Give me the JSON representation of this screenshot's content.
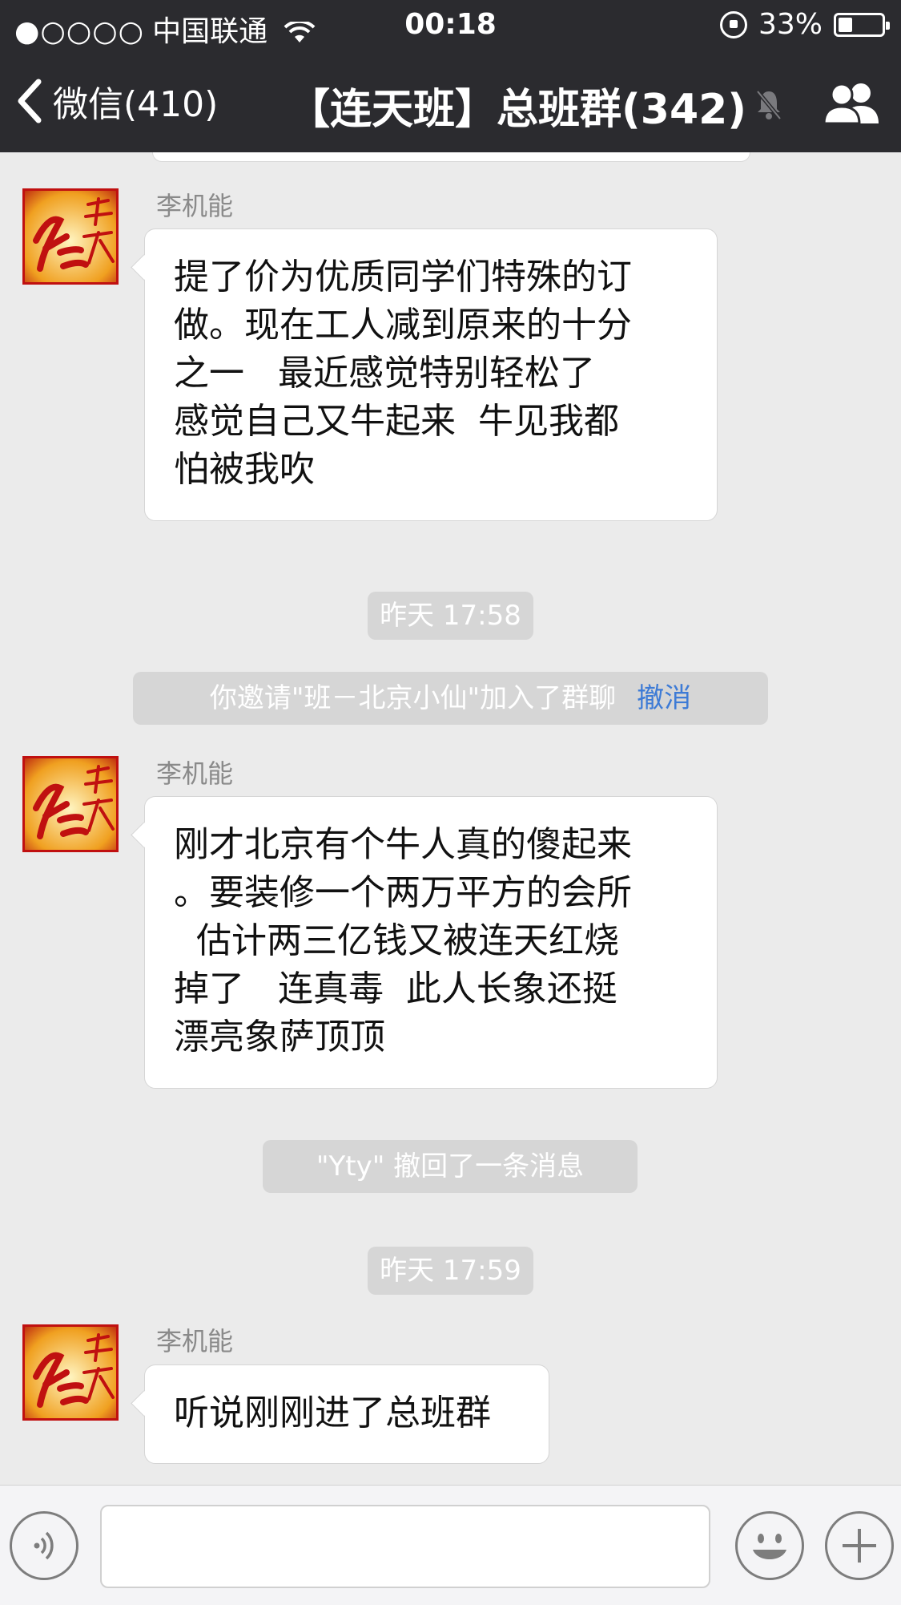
{
  "status_bar": {
    "signal_dots": "●○○○○",
    "carrier": "中国联通",
    "time": "00:18",
    "battery_text": "33%",
    "battery_level": 0.33
  },
  "nav": {
    "back_label": "微信(410)",
    "title": "【连天班】总班群(342)"
  },
  "messages": [
    {
      "sender": "李机能",
      "text": "提了价为优质同学们特殊的订\n做。现在工人减到原来的十分\n之一   最近感觉特别轻松了\n感觉自己又牛起来  牛见我都\n怕被我吹"
    },
    {
      "sender": "李机能",
      "text": "刚才北京有个牛人真的傻起来\n。要装修一个两万平方的会所\n  估计两三亿钱又被连天红烧\n掉了   连真毒  此人长象还挺\n漂亮象萨顶顶"
    },
    {
      "sender": "李机能",
      "text": "听说刚刚进了总班群"
    }
  ],
  "system": {
    "time_1": "昨天 17:58",
    "invite_text": "你邀请\"班－北京小仙\"加入了群聊",
    "invite_action": "撤消",
    "recall_text": "\"Yty\" 撤回了一条消息",
    "time_2": "昨天 17:59"
  },
  "icons": {
    "back": "chevron-left-icon",
    "mute": "mute-bell-icon",
    "members": "group-members-icon",
    "voice": "voice-icon",
    "emoji": "emoji-icon",
    "more": "plus-icon"
  },
  "colors": {
    "nav_bg": "#2b2b2f",
    "chat_bg": "#ebebeb",
    "link": "#3d7bd6"
  }
}
